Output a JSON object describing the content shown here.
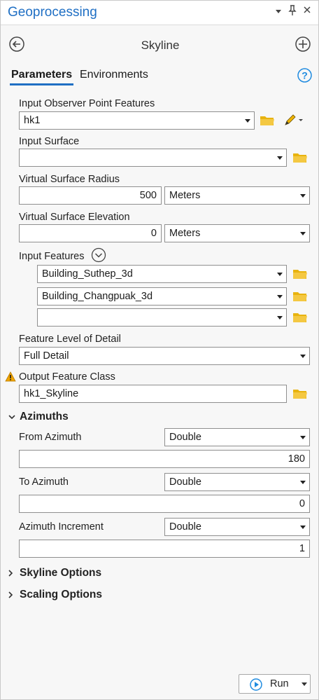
{
  "window": {
    "title": "Geoprocessing",
    "dropdown_glyph": "▾",
    "pin_glyph": "📌",
    "close_glyph": "✕"
  },
  "tool": {
    "name": "Skyline"
  },
  "tabs": [
    {
      "label": "Parameters",
      "active": true
    },
    {
      "label": "Environments",
      "active": false
    }
  ],
  "colors": {
    "accent": "#1f6fc4",
    "folder": "#e8b30f",
    "warning": "#f0a400"
  },
  "params": {
    "observer_points": {
      "label": "Input Observer Point Features",
      "value": "hk1"
    },
    "input_surface": {
      "label": "Input Surface",
      "value": ""
    },
    "virtual_radius": {
      "label": "Virtual Surface Radius",
      "value": "500",
      "unit": "Meters"
    },
    "virtual_elevation": {
      "label": "Virtual Surface Elevation",
      "value": "0",
      "unit": "Meters"
    },
    "input_features": {
      "label": "Input Features",
      "items": [
        "Building_Suthep_3d",
        "Building_Changpuak_3d",
        ""
      ]
    },
    "level_of_detail": {
      "label": "Feature Level of Detail",
      "value": "Full Detail"
    },
    "output_feature_class": {
      "label": "Output Feature Class",
      "value": "hk1_Skyline"
    }
  },
  "azimuths": {
    "title": "Azimuths",
    "from": {
      "label": "From Azimuth",
      "type": "Double",
      "value": "180"
    },
    "to": {
      "label": "To Azimuth",
      "type": "Double",
      "value": "0"
    },
    "increment": {
      "label": "Azimuth Increment",
      "type": "Double",
      "value": "1"
    }
  },
  "collapsed_sections": {
    "skyline_options": "Skyline Options",
    "scaling_options": "Scaling Options"
  },
  "run": {
    "label": "Run"
  }
}
